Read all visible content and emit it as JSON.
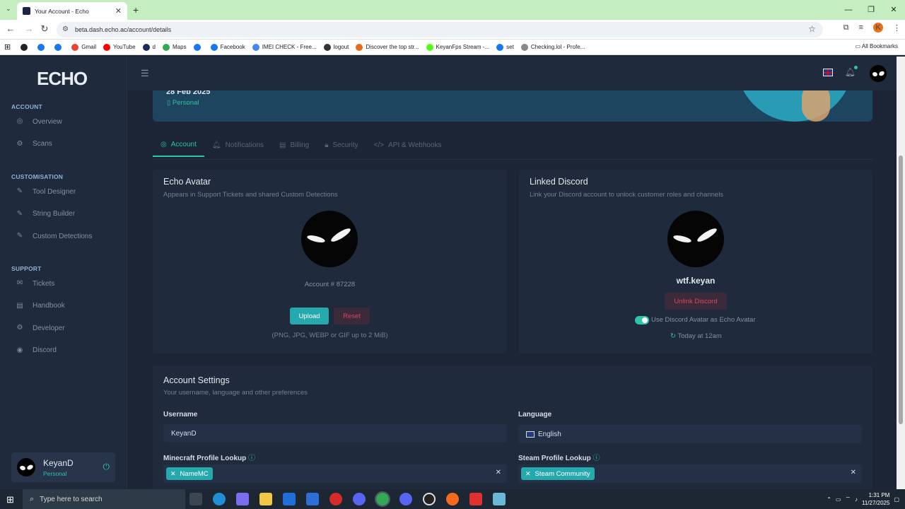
{
  "browser": {
    "tab_title": "Your Account - Echo",
    "url": "beta.dash.echo.ac/account/details",
    "bookmarks": [
      {
        "label": "",
        "color": "#222222"
      },
      {
        "label": "",
        "color": "#1877f2"
      },
      {
        "label": "",
        "color": "#1877f2"
      },
      {
        "label": "Gmail",
        "color": "#ea4335"
      },
      {
        "label": "YouTube",
        "color": "#ff0000"
      },
      {
        "label": "d",
        "color": "#1a2b5a"
      },
      {
        "label": "Maps",
        "color": "#34a853"
      },
      {
        "label": "",
        "color": "#1877f2"
      },
      {
        "label": "Facebook",
        "color": "#1877f2"
      },
      {
        "label": "IMEI CHECK - Free...",
        "color": "#4285f4"
      },
      {
        "label": "logout",
        "color": "#333333"
      },
      {
        "label": "Discover the top str...",
        "color": "#e86b1c"
      },
      {
        "label": "KeyanFps Stream -...",
        "color": "#53fc18"
      },
      {
        "label": "set",
        "color": "#1877f2"
      },
      {
        "label": "Checking.lol - Profe...",
        "color": "#888888"
      }
    ],
    "all_bookmarks": "All Bookmarks",
    "profile_initial": "K"
  },
  "sidebar": {
    "logo": "ECHO",
    "sections": [
      {
        "title": "ACCOUNT",
        "items": [
          "Overview",
          "Scans"
        ]
      },
      {
        "title": "CUSTOMISATION",
        "items": [
          "Tool Designer",
          "String Builder",
          "Custom Detections"
        ]
      },
      {
        "title": "SUPPORT",
        "items": [
          "Tickets",
          "Handbook",
          "Developer",
          "Discord"
        ]
      }
    ],
    "user": {
      "name": "KeyanD",
      "plan": "Personal"
    }
  },
  "banner": {
    "date": "28 Feb 2025",
    "plan": "Personal"
  },
  "tabs": [
    "Account",
    "Notifications",
    "Billing",
    "Security",
    "API & Webhooks"
  ],
  "avatar_card": {
    "title": "Echo Avatar",
    "subtitle": "Appears in Support Tickets and shared Custom Detections",
    "account": "Account # 87228",
    "upload": "Upload",
    "reset": "Reset",
    "hint": "(PNG, JPG, WEBP or GIF up to 2 MiB)"
  },
  "discord_card": {
    "title": "Linked Discord",
    "subtitle": "Link your Discord account to unlock customer roles and channels",
    "username": "wtf.keyan",
    "unlink": "Unlink Discord",
    "toggle_label": "Use Discord Avatar as Echo Avatar",
    "toggle_on": true,
    "updated": "Today at 12am"
  },
  "settings": {
    "title": "Account Settings",
    "subtitle": "Your username, language and other preferences",
    "username_label": "Username",
    "username_value": "KeyanD",
    "language_label": "Language",
    "language_value": "English",
    "minecraft_label": "Minecraft Profile Lookup",
    "minecraft_chip": "NameMC",
    "steam_label": "Steam Profile Lookup",
    "steam_chip": "Steam Community"
  },
  "taskbar": {
    "search_placeholder": "Type here to search",
    "time": "1:31 PM",
    "date": "11/27/2025"
  },
  "colors": {
    "accent": "#2ec4a5",
    "danger": "#e0455e",
    "upload": "#26a9ad"
  }
}
